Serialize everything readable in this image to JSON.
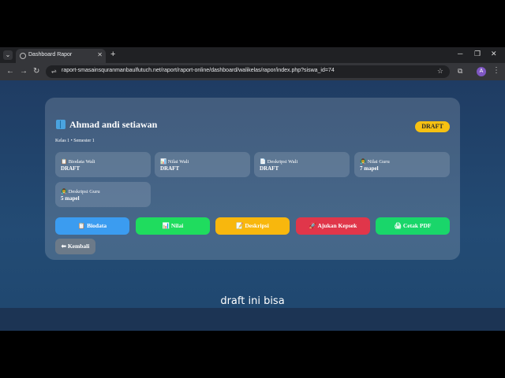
{
  "browser": {
    "tab_menu_icon": "⌄",
    "tab_title": "Dashboard Rapor",
    "tab_close": "✕",
    "new_tab": "+",
    "win_min": "─",
    "win_max": "❐",
    "win_close": "✕",
    "back": "←",
    "forward": "→",
    "reload": "↻",
    "site_icon": "⇌",
    "url": "raport-smasainsquranmanbaulfutuch.net/raport/raport-online/dashboard/walikelas/rapor/index.php?siswa_id=74",
    "star": "☆",
    "extensions": "⧉",
    "profile_initial": "A",
    "menu": "⋮"
  },
  "student": {
    "name_icon": "book-icon",
    "name": "Ahmad andi setiawan",
    "status": "DRAFT",
    "meta": "Kelas 1 • Semester 1"
  },
  "info_cards": [
    {
      "icon": "📋",
      "label": "Biodata Wali",
      "value": "DRAFT"
    },
    {
      "icon": "📊",
      "label": "Nilai Wali",
      "value": "DRAFT"
    },
    {
      "icon": "📄",
      "label": "Deskripsi Wali",
      "value": "DRAFT"
    },
    {
      "icon": "👨‍🏫",
      "label": "Nilai Guru",
      "value": "7 mapel"
    },
    {
      "icon": "👨‍🏫",
      "label": "Deskripsi Guru",
      "value": "5 mapel"
    }
  ],
  "actions": [
    {
      "icon": "📋",
      "label": "Biodata",
      "color": "#3b9cf0"
    },
    {
      "icon": "📊",
      "label": "Nilai",
      "color": "#1fdc5e"
    },
    {
      "icon": "📝",
      "label": "Deskripsi",
      "color": "#f8b70d"
    },
    {
      "icon": "🚀",
      "label": "Ajukan Kepsek",
      "color": "#e0364a"
    },
    {
      "icon": "🖨",
      "label": "Cetak PDF",
      "color": "#19d66a"
    }
  ],
  "back_button": {
    "icon": "⬅",
    "label": "Kembali"
  },
  "subtitle": "draft ini bisa"
}
